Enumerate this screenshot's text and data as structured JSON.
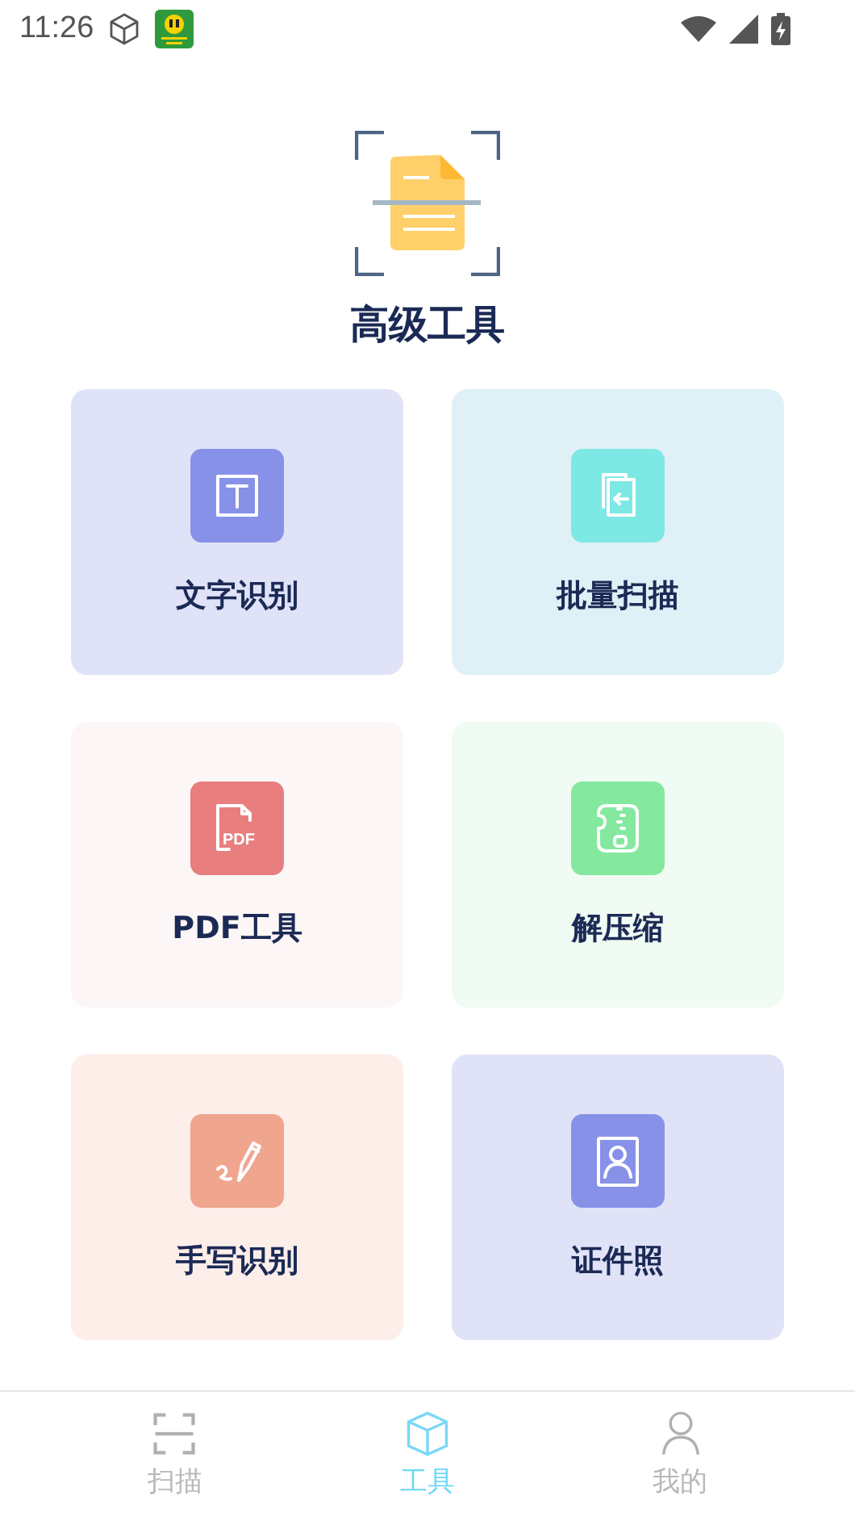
{
  "status_bar": {
    "time": "11:26"
  },
  "header": {
    "title": "高级工具"
  },
  "tools": [
    {
      "label": "文字识别",
      "kind": "text",
      "color": "#8891e8"
    },
    {
      "label": "批量扫描",
      "kind": "batch",
      "color": "#7ee8e4"
    },
    {
      "label": "PDF工具",
      "kind": "pdf",
      "color": "#e87e7e",
      "icon_text": "PDF"
    },
    {
      "label": "解压缩",
      "kind": "zip",
      "color": "#84e89e"
    },
    {
      "label": "手写识别",
      "kind": "handwriting",
      "color": "#f0a58f"
    },
    {
      "label": "证件照",
      "kind": "idphoto",
      "color": "#8891e8"
    }
  ],
  "tabs": [
    {
      "label": "扫描",
      "kind": "scan",
      "selected": false
    },
    {
      "label": "工具",
      "kind": "tools",
      "selected": true
    },
    {
      "label": "我的",
      "kind": "me",
      "selected": false
    }
  ]
}
